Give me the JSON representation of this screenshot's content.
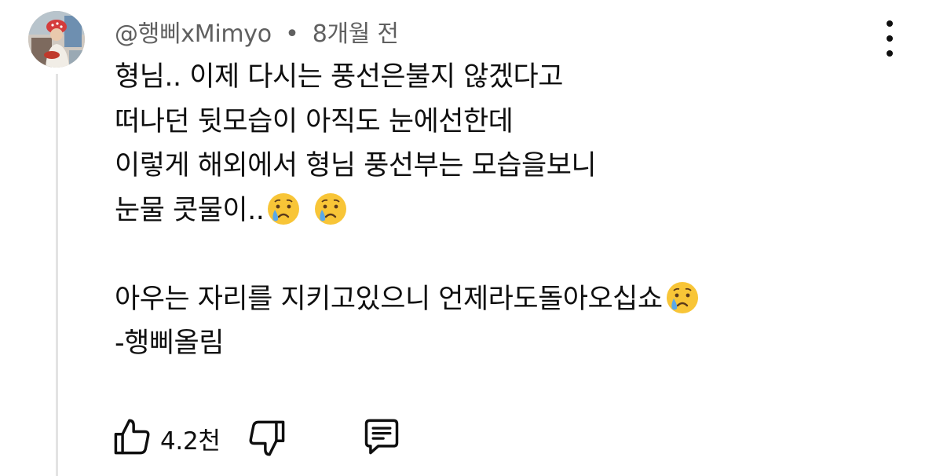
{
  "comment": {
    "author": "@행삐xMimyo",
    "separator": "•",
    "timestamp": "8개월 전",
    "lines": [
      "형님..  이제 다시는 풍선은불지 않겠다고",
      "떠나던 뒷모습이 아직도 눈에선한데",
      "이렇게 해외에서 형님 풍선부는 모습을보니",
      "눈물 콧물이..",
      "",
      "아우는 자리를 지키고있으니 언제라도돌아오십쇼",
      "-행삐올림"
    ],
    "emojis": [
      "crying-face",
      "crying-face",
      "crying-face"
    ],
    "like_count": "4.2천"
  },
  "icons": {
    "more": "more-vert-icon",
    "like": "thumb-up-icon",
    "dislike": "thumb-down-icon",
    "reply": "comment-icon"
  },
  "colors": {
    "text": "#0f0f0f",
    "meta": "#606060",
    "thread_line": "#e3e3e3",
    "emoji_face": "#f8c537",
    "emoji_tear": "#5aa8e8"
  }
}
